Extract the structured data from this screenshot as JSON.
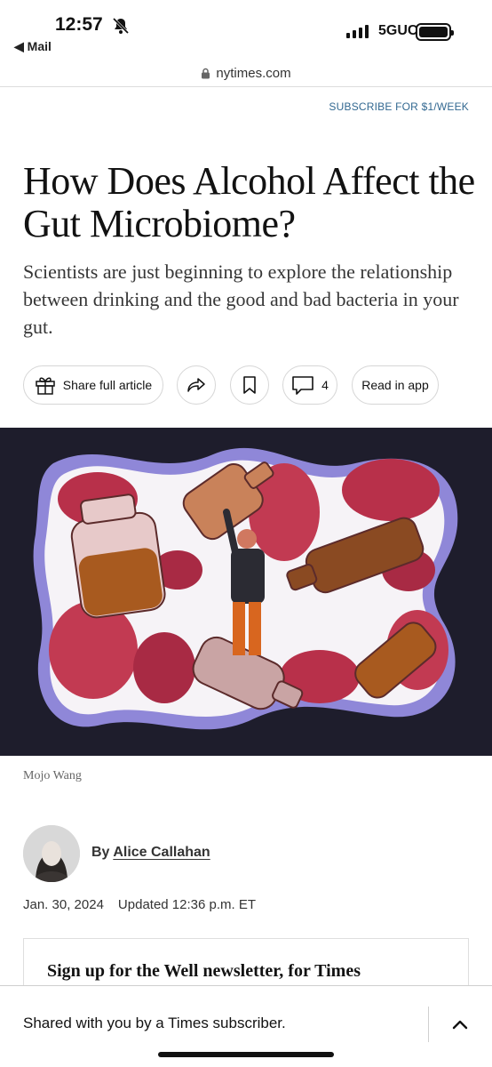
{
  "status_bar": {
    "time": "12:57",
    "back_app": "◀ Mail",
    "network": "5GUC"
  },
  "browser": {
    "url": "nytimes.com"
  },
  "header": {
    "subscribe_label": "SUBSCRIBE FOR $1/WEEK"
  },
  "article": {
    "headline": "How Does Alcohol Affect the Gut Microbiome?",
    "summary": "Scientists are just beginning to explore the relationship between drinking and the good and bad bacteria in your gut.",
    "actions": {
      "share_full_article": "Share full article",
      "comments_count": "4",
      "read_in_app": "Read in app"
    },
    "image_caption": "Mojo Wang",
    "byline_prefix": "By",
    "author": "Alice Callahan",
    "published": "Jan. 30, 2024",
    "updated": "Updated 12:36 p.m. ET",
    "newsletter_title": "Sign up for the Well newsletter, for Times"
  },
  "share_bar": {
    "text": "Shared with you by a Times subscriber."
  },
  "colors": {
    "link_blue": "#326891",
    "hero_bg": "#1e1d2c",
    "outline_purple": "#9b93e6",
    "flesh_red": "#b8304a"
  },
  "icons": [
    "bell-slash-icon",
    "lock-icon",
    "gift-icon",
    "share-arrow-icon",
    "bookmark-icon",
    "comment-icon",
    "chevron-up-icon"
  ]
}
